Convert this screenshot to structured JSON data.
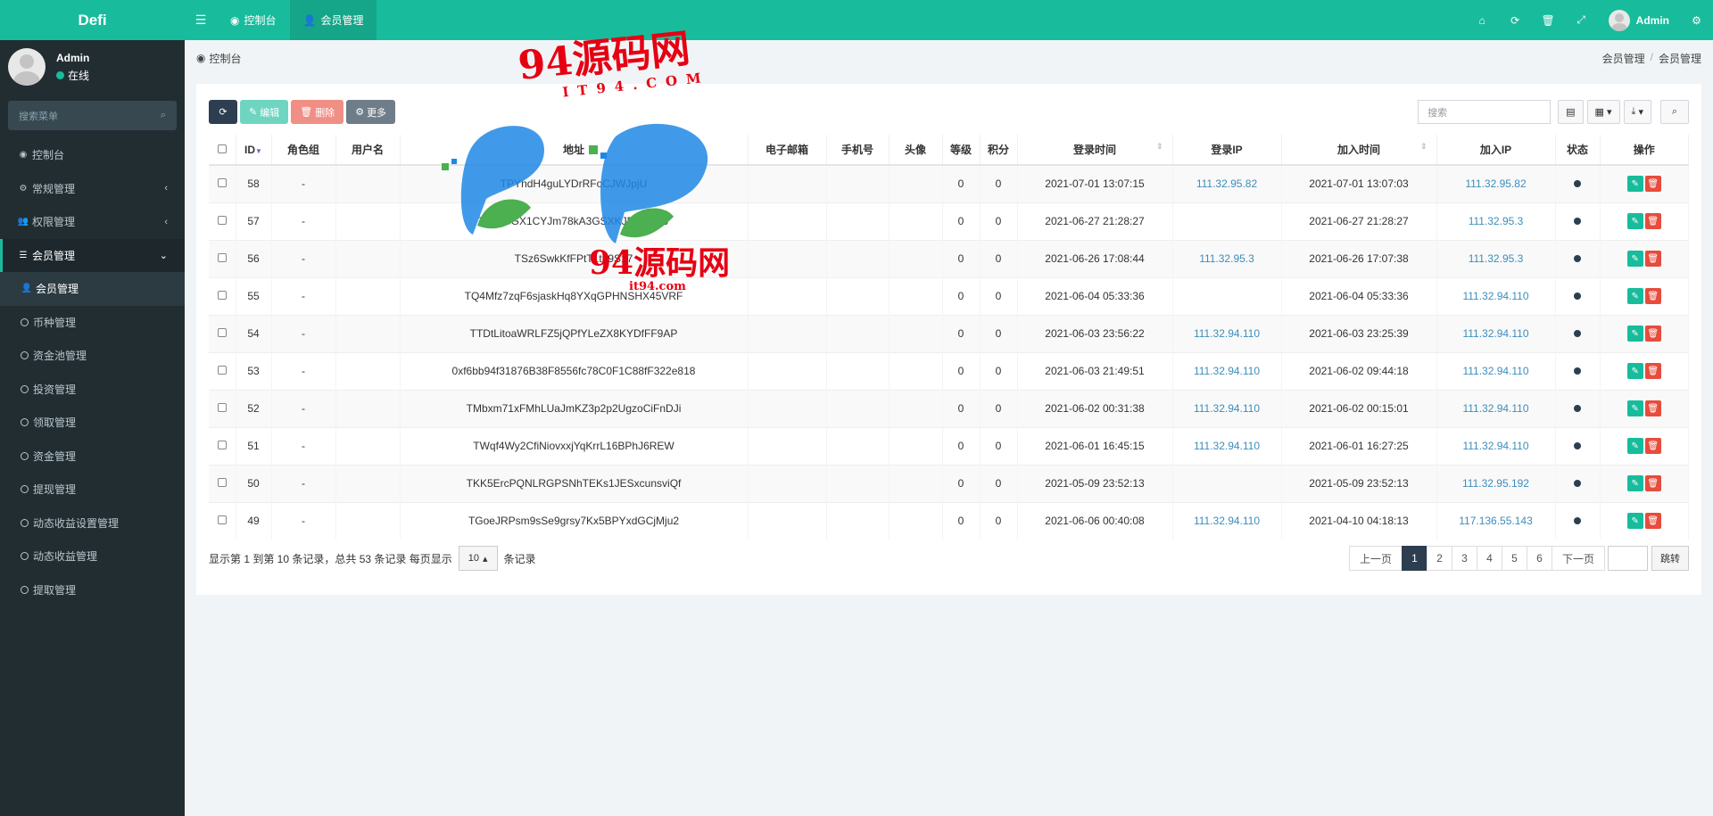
{
  "app": {
    "title": "Defi"
  },
  "topbar": {
    "tabs": [
      {
        "label": "控制台",
        "icon": "dashboard-icon"
      },
      {
        "label": "会员管理",
        "icon": "user-icon"
      }
    ],
    "user_name": "Admin"
  },
  "sidebar": {
    "user_name": "Admin",
    "user_status": "在线",
    "search_placeholder": "搜索菜单",
    "items": [
      {
        "label": "控制台",
        "icon": "dashboard-icon"
      },
      {
        "label": "常规管理",
        "icon": "cogs-icon"
      },
      {
        "label": "权限管理",
        "icon": "group-icon"
      },
      {
        "label": "会员管理",
        "icon": "list-icon"
      },
      {
        "label": "会员管理",
        "icon": "user-icon"
      },
      {
        "label": "币种管理",
        "icon": "circle-icon"
      },
      {
        "label": "资金池管理",
        "icon": "circle-icon"
      },
      {
        "label": "投资管理",
        "icon": "circle-icon"
      },
      {
        "label": "领取管理",
        "icon": "circle-icon"
      },
      {
        "label": "资金管理",
        "icon": "circle-icon"
      },
      {
        "label": "提现管理",
        "icon": "circle-icon"
      },
      {
        "label": "动态收益设置管理",
        "icon": "circle-icon"
      },
      {
        "label": "动态收益管理",
        "icon": "circle-icon"
      },
      {
        "label": "提取管理",
        "icon": "circle-icon"
      }
    ]
  },
  "content": {
    "page_title": "控制台",
    "breadcrumb": [
      "会员管理",
      "会员管理"
    ]
  },
  "toolbar": {
    "edit_label": "编辑",
    "delete_label": "删除",
    "more_label": "更多",
    "search_placeholder": "搜索"
  },
  "table": {
    "columns": [
      "ID",
      "角色组",
      "用户名",
      "地址",
      "电子邮箱",
      "手机号",
      "头像",
      "等级",
      "积分",
      "登录时间",
      "登录IP",
      "加入时间",
      "加入IP",
      "状态",
      "操作"
    ],
    "rows": [
      {
        "id": "58",
        "role": "-",
        "username": "",
        "address": "TPYndH4guLYDrRFoCJWJpjU",
        "email": "",
        "phone": "",
        "avatar": "",
        "level": "0",
        "score": "0",
        "login_time": "2021-07-01 13:07:15",
        "login_ip": "111.32.95.82",
        "join_time": "2021-07-01 13:07:03",
        "join_ip": "111.32.95.82"
      },
      {
        "id": "57",
        "role": "-",
        "username": "",
        "address": "TFkhCGX1CYJm78kA3GSXKJF74fANJ",
        "email": "",
        "phone": "",
        "avatar": "",
        "level": "0",
        "score": "0",
        "login_time": "2021-06-27 21:28:27",
        "login_ip": "",
        "join_time": "2021-06-27 21:28:27",
        "join_ip": "111.32.95.3"
      },
      {
        "id": "56",
        "role": "-",
        "username": "",
        "address": "TSz6SwkKfFPtT1tL9S17",
        "email": "",
        "phone": "",
        "avatar": "",
        "level": "0",
        "score": "0",
        "login_time": "2021-06-26 17:08:44",
        "login_ip": "111.32.95.3",
        "join_time": "2021-06-26 17:07:38",
        "join_ip": "111.32.95.3"
      },
      {
        "id": "55",
        "role": "-",
        "username": "",
        "address": "TQ4Mfz7zqF6sjaskHq8YXqGPHNSHX45VRF",
        "email": "",
        "phone": "",
        "avatar": "",
        "level": "0",
        "score": "0",
        "login_time": "2021-06-04 05:33:36",
        "login_ip": "",
        "join_time": "2021-06-04 05:33:36",
        "join_ip": "111.32.94.110"
      },
      {
        "id": "54",
        "role": "-",
        "username": "",
        "address": "TTDtLitoaWRLFZ5jQPfYLeZX8KYDfFF9AP",
        "email": "",
        "phone": "",
        "avatar": "",
        "level": "0",
        "score": "0",
        "login_time": "2021-06-03 23:56:22",
        "login_ip": "111.32.94.110",
        "join_time": "2021-06-03 23:25:39",
        "join_ip": "111.32.94.110"
      },
      {
        "id": "53",
        "role": "-",
        "username": "",
        "address": "0xf6bb94f31876B38F8556fc78C0F1C88fF322e818",
        "email": "",
        "phone": "",
        "avatar": "",
        "level": "0",
        "score": "0",
        "login_time": "2021-06-03 21:49:51",
        "login_ip": "111.32.94.110",
        "join_time": "2021-06-02 09:44:18",
        "join_ip": "111.32.94.110"
      },
      {
        "id": "52",
        "role": "-",
        "username": "",
        "address": "TMbxm71xFMhLUaJmKZ3p2p2UgzoCiFnDJi",
        "email": "",
        "phone": "",
        "avatar": "",
        "level": "0",
        "score": "0",
        "login_time": "2021-06-02 00:31:38",
        "login_ip": "111.32.94.110",
        "join_time": "2021-06-02 00:15:01",
        "join_ip": "111.32.94.110"
      },
      {
        "id": "51",
        "role": "-",
        "username": "",
        "address": "TWqf4Wy2CfiNiovxxjYqKrrL16BPhJ6REW",
        "email": "",
        "phone": "",
        "avatar": "",
        "level": "0",
        "score": "0",
        "login_time": "2021-06-01 16:45:15",
        "login_ip": "111.32.94.110",
        "join_time": "2021-06-01 16:27:25",
        "join_ip": "111.32.94.110"
      },
      {
        "id": "50",
        "role": "-",
        "username": "",
        "address": "TKK5ErcPQNLRGPSNhTEKs1JESxcunsviQf",
        "email": "",
        "phone": "",
        "avatar": "",
        "level": "0",
        "score": "0",
        "login_time": "2021-05-09 23:52:13",
        "login_ip": "",
        "join_time": "2021-05-09 23:52:13",
        "join_ip": "111.32.95.192"
      },
      {
        "id": "49",
        "role": "-",
        "username": "",
        "address": "TGoeJRPsm9sSe9grsy7Kx5BPYxdGCjMju2",
        "email": "",
        "phone": "",
        "avatar": "",
        "level": "0",
        "score": "0",
        "login_time": "2021-06-06 00:40:08",
        "login_ip": "111.32.94.110",
        "join_time": "2021-04-10 04:18:13",
        "join_ip": "117.136.55.143"
      }
    ]
  },
  "footer": {
    "info_prefix": "显示第 1 到第 10 条记录，总共 53 条记录 每页显示",
    "page_size": "10",
    "info_suffix": "条记录"
  },
  "pagination": {
    "prev": "上一页",
    "pages": [
      "1",
      "2",
      "3",
      "4",
      "5",
      "6"
    ],
    "current": "1",
    "next": "下一页",
    "go": "跳转"
  },
  "watermark": {
    "title": "94源码网",
    "sub": "IT94.COM",
    "title2": "94源码网",
    "sub2": "it94.com"
  }
}
